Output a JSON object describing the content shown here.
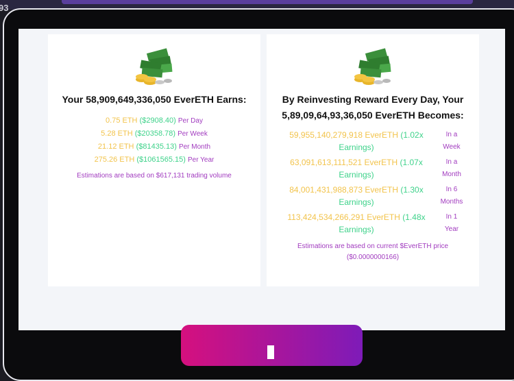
{
  "corner": {
    "label": "93"
  },
  "left_card": {
    "title": "Your 58,909,649,336,050 EverETH Earns:",
    "rows": [
      {
        "eth": "0.75 ETH",
        "usd": "($2908.40)",
        "period": "Per Day"
      },
      {
        "eth": "5.28 ETH",
        "usd": "($20358.78)",
        "period": "Per Week"
      },
      {
        "eth": "21.12 ETH",
        "usd": "($81435.13)",
        "period": "Per Month"
      },
      {
        "eth": "275.26 ETH",
        "usd": "($1061565.15)",
        "period": "Per Year"
      }
    ],
    "note": "Estimations are based on $617,131 trading volume"
  },
  "right_card": {
    "title": "By Reinvesting Reward Every Day, Your 5,89,09,64,93,36,050 EverETH Becomes:",
    "rows": [
      {
        "amount": "59,955,140,279,918 EverETH",
        "mult": "(1.02x",
        "earn": "Earnings)",
        "when": "In a Week"
      },
      {
        "amount": "63,091,613,111,521 EverETH",
        "mult": "(1.07x",
        "earn": "Earnings)",
        "when": "In a Month"
      },
      {
        "amount": "84,001,431,988,873 EverETH",
        "mult": "(1.30x",
        "earn": "Earnings)",
        "when": "In 6 Months"
      },
      {
        "amount": "113,424,534,266,291 EverETH",
        "mult": "(1.48x",
        "earn": "Earnings)",
        "when": "In 1 Year"
      }
    ],
    "note": "Estimations are based on current $EverETH price ($0.0000000166)"
  },
  "icons": {
    "money": "money-stack-icon"
  },
  "colors": {
    "eth": "#f2c34b",
    "usd": "#3ed28a",
    "accent": "#a13bbf"
  }
}
